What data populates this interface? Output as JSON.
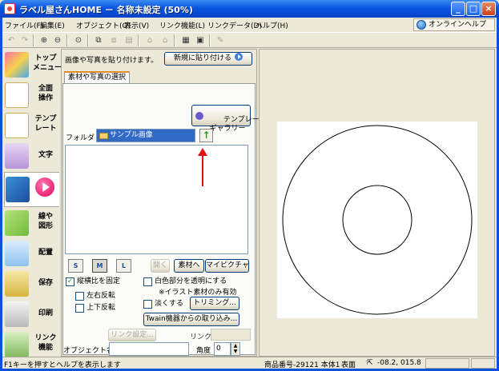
{
  "window": {
    "title": "ラベル屋さんHOME － 名称未設定 (50%)"
  },
  "menu": {
    "items": [
      "ファイル(F)",
      "編集(E)",
      "オブジェクト(O)",
      "表示(V)",
      "リンク機能(L)",
      "リンクデータ(D)",
      "ヘルプ(H)"
    ],
    "online_help": "オンラインヘルプ"
  },
  "sidebar": {
    "items": [
      {
        "label": "トップ\nメニュー",
        "icon": "home-icon"
      },
      {
        "label": "全面\n操作",
        "icon": "layout-icon"
      },
      {
        "label": "テンプ\nレート",
        "icon": "template-icon"
      },
      {
        "label": "文字",
        "icon": "text-icon"
      },
      {
        "label": "",
        "icon": "image-icon",
        "active": true
      },
      {
        "label": "線や\n図形",
        "icon": "shape-icon"
      },
      {
        "label": "配置",
        "icon": "align-icon"
      },
      {
        "label": "保存",
        "icon": "save-icon"
      },
      {
        "label": "印刷",
        "icon": "print-icon"
      },
      {
        "label": "リンク\n機能",
        "icon": "link-icon"
      }
    ]
  },
  "panel": {
    "caption": "画像や写真を貼り付けます。",
    "new_paste": "新規に貼り付ける",
    "tab": "素材や写真の選択",
    "gallery_btn": "テンプレート\nギャラリー",
    "folder_label": "フォルダ",
    "folder_value": "サンプル画像",
    "size_buttons": [
      "S",
      "M",
      "L"
    ],
    "open_btn": "開く",
    "to_material_btn": "素材へ",
    "my_picture_btn": "マイピクチャ",
    "keep_ratio": "縦横比を固定",
    "flip_h": "左右反転",
    "flip_v": "上下反転",
    "transparent_white": "白色部分を透明にする",
    "illust_only_note": "※イラスト素材のみ有効",
    "lighten": "淡くする",
    "trimming_btn": "トリミング...",
    "twain_btn": "Twain機器からの取り込み...",
    "link_settings_btn": "リンク設定...",
    "link_col_label": "リンク列",
    "object_name_label": "オブジェクト名",
    "angle_label": "角度",
    "angle_value": "0"
  },
  "status": {
    "help": "F1キーを押すとヘルプを表示します",
    "product": "商品番号-29121 本体1",
    "side": "表面",
    "coords": "-08.2, 015.8"
  }
}
